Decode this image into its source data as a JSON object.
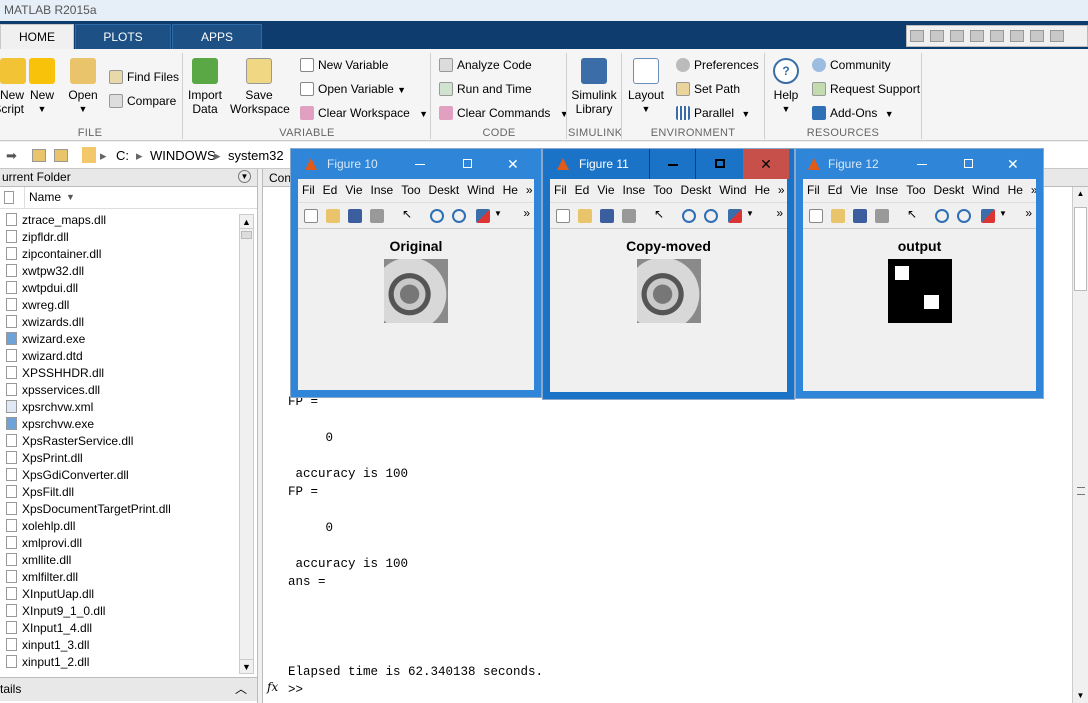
{
  "app": {
    "title": "MATLAB R2015a"
  },
  "tabs": [
    {
      "label": "HOME"
    },
    {
      "label": "PLOTS"
    },
    {
      "label": "APPS"
    }
  ],
  "ribbon": {
    "file": {
      "new_script": "New\nScript",
      "new": "New",
      "open": "Open",
      "find_files": "Find Files",
      "compare": "Compare",
      "section": "FILE"
    },
    "variable": {
      "import_data": "Import\nData",
      "save_workspace": "Save\nWorkspace",
      "new_variable": "New Variable",
      "open_variable": "Open Variable",
      "clear_workspace": "Clear Workspace",
      "section": "VARIABLE"
    },
    "code": {
      "analyze_code": "Analyze Code",
      "run_and_time": "Run and Time",
      "clear_commands": "Clear Commands",
      "section": "CODE"
    },
    "simulink": {
      "library": "Simulink\nLibrary",
      "section": "SIMULINK"
    },
    "environment": {
      "layout": "Layout",
      "preferences": "Preferences",
      "set_path": "Set Path",
      "parallel": "Parallel",
      "section": "ENVIRONMENT"
    },
    "resources": {
      "help": "Help",
      "community": "Community",
      "request_support": "Request Support",
      "add_ons": "Add-Ons",
      "section": "RESOURCES"
    }
  },
  "address": {
    "drive": "C:",
    "folder1": "WINDOWS",
    "folder2": "system32"
  },
  "current_folder": {
    "title": "urrent Folder",
    "column": "Name",
    "files": [
      {
        "name": "ztrace_maps.dll"
      },
      {
        "name": "zipfldr.dll"
      },
      {
        "name": "zipcontainer.dll"
      },
      {
        "name": "xwtpw32.dll"
      },
      {
        "name": "xwtpdui.dll"
      },
      {
        "name": "xwreg.dll"
      },
      {
        "name": "xwizards.dll"
      },
      {
        "name": "xwizard.exe"
      },
      {
        "name": "xwizard.dtd"
      },
      {
        "name": "XPSSHHDR.dll"
      },
      {
        "name": "xpsservices.dll"
      },
      {
        "name": "xpsrchvw.xml"
      },
      {
        "name": "xpsrchvw.exe"
      },
      {
        "name": "XpsRasterService.dll"
      },
      {
        "name": "XpsPrint.dll"
      },
      {
        "name": "XpsGdiConverter.dll"
      },
      {
        "name": "XpsFilt.dll"
      },
      {
        "name": "XpsDocumentTargetPrint.dll"
      },
      {
        "name": "xolehlp.dll"
      },
      {
        "name": "xmlprovi.dll"
      },
      {
        "name": "xmllite.dll"
      },
      {
        "name": "xmlfilter.dll"
      },
      {
        "name": "XInputUap.dll"
      },
      {
        "name": "XInput9_1_0.dll"
      },
      {
        "name": "XInput1_4.dll"
      },
      {
        "name": "xinput1_3.dll"
      },
      {
        "name": "xinput1_2.dll"
      }
    ],
    "details": "tails"
  },
  "command_window": {
    "title": "Con",
    "lines": {
      "fp1": "FP =",
      "zero1": "     0",
      "acc1": " accuracy is 100",
      "fp2": "FP =",
      "zero2": "     0",
      "acc2": " accuracy is 100",
      "ans": "ans =",
      "elapsed": "Elapsed time is 62.340138 seconds.",
      "prompt": ">>",
      "fx": "fx"
    }
  },
  "figures": [
    {
      "title": "Figure 10",
      "plot_title": "Original"
    },
    {
      "title": "Figure 11",
      "plot_title": "Copy-moved"
    },
    {
      "title": "Figure 12",
      "plot_title": "output"
    }
  ],
  "figure_menu": {
    "file": "Fil",
    "edit": "Ed",
    "view": "Vie",
    "insert": "Inse",
    "tools": "Too",
    "desktop": "Deskt",
    "window": "Wind",
    "help": "He",
    "more": "»"
  }
}
